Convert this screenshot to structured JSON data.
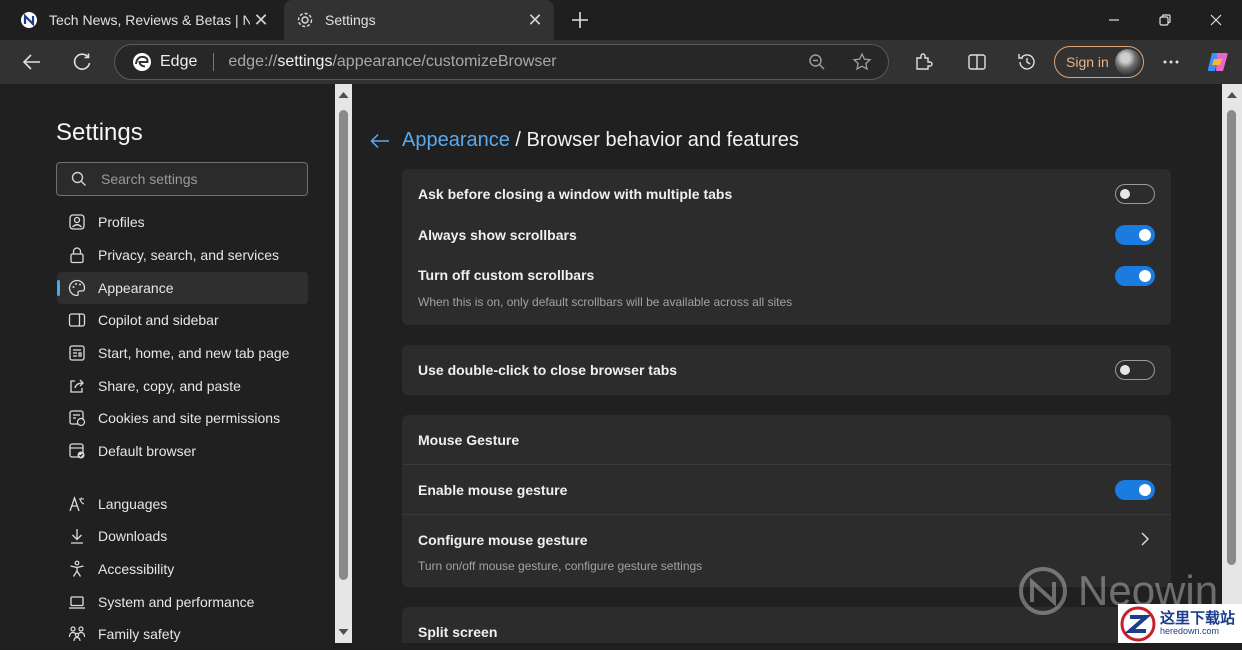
{
  "tabs": [
    {
      "title": "Tech News, Reviews & Betas | Neowin",
      "close": "✕"
    },
    {
      "title": "Settings",
      "close": "✕"
    }
  ],
  "toolbar": {
    "browser_name": "Edge",
    "url_scheme": "edge://",
    "url_host": "settings",
    "url_path": "/appearance/customizeBrowser",
    "signin_label": "Sign in"
  },
  "sidebar": {
    "title": "Settings",
    "search_placeholder": "Search settings",
    "items": [
      {
        "label": "Profiles",
        "icon": "profile-icon"
      },
      {
        "label": "Privacy, search, and services",
        "icon": "lock-icon"
      },
      {
        "label": "Appearance",
        "icon": "palette-icon",
        "active": true
      },
      {
        "label": "Copilot and sidebar",
        "icon": "sidebar-icon"
      },
      {
        "label": "Start, home, and new tab page",
        "icon": "home-grid-icon"
      },
      {
        "label": "Share, copy, and paste",
        "icon": "share-icon"
      },
      {
        "label": "Cookies and site permissions",
        "icon": "cookie-grid-icon"
      },
      {
        "label": "Default browser",
        "icon": "browser-check-icon"
      },
      {
        "label": "Languages",
        "icon": "language-icon"
      },
      {
        "label": "Downloads",
        "icon": "download-icon"
      },
      {
        "label": "Accessibility",
        "icon": "accessibility-icon"
      },
      {
        "label": "System and performance",
        "icon": "laptop-icon"
      },
      {
        "label": "Family safety",
        "icon": "family-icon"
      }
    ]
  },
  "main": {
    "breadcrumb_link": "Appearance",
    "breadcrumb_rest": " / Browser behavior and features",
    "card1": {
      "rows": [
        {
          "label": "Ask before closing a window with multiple tabs",
          "toggle": false
        },
        {
          "label": "Always show scrollbars",
          "toggle": true
        },
        {
          "label": "Turn off custom scrollbars",
          "toggle": true,
          "description": "When this is on, only default scrollbars will be available across all sites"
        }
      ]
    },
    "card2": {
      "rows": [
        {
          "label": "Use double-click to close browser tabs",
          "toggle": false
        }
      ]
    },
    "card3": {
      "header": "Mouse Gesture",
      "rows": [
        {
          "label": "Enable mouse gesture",
          "toggle": true
        },
        {
          "label": "Configure mouse gesture",
          "description": "Turn on/off mouse gesture, configure gesture settings"
        }
      ]
    },
    "card4": {
      "header": "Split screen"
    }
  },
  "watermark": {
    "text": "Neowin"
  },
  "badge": {
    "cn": "这里下载站",
    "en": "heredown.com"
  },
  "colors": {
    "accent": "#1a7be0",
    "link": "#5aaaf0",
    "signin": "#e8b48a"
  }
}
